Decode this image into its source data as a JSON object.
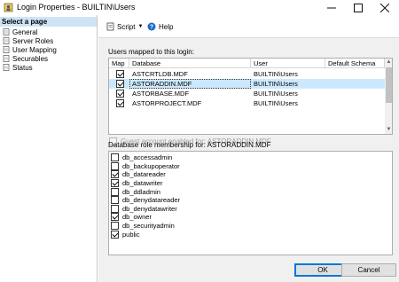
{
  "window": {
    "title": "Login Properties - BUILTIN\\Users",
    "buttons": [
      "minimize",
      "maximize",
      "close"
    ]
  },
  "left_pane": {
    "header": "Select a page",
    "items": [
      {
        "label": "General",
        "icon": "page-icon"
      },
      {
        "label": "Server Roles",
        "icon": "page-icon"
      },
      {
        "label": "User Mapping",
        "icon": "page-icon"
      },
      {
        "label": "Securables",
        "icon": "page-icon"
      },
      {
        "label": "Status",
        "icon": "page-icon"
      }
    ]
  },
  "toolbar": {
    "script_label": "Script",
    "help_label": "Help"
  },
  "users_mapped": {
    "label": "Users mapped to this login:",
    "columns": [
      "Map",
      "Database",
      "User",
      "Default Schema"
    ],
    "rows": [
      {
        "map": true,
        "database": "ASTCRTLDB.MDF",
        "user": "BUILTIN\\Users",
        "schema": "",
        "selected": false
      },
      {
        "map": true,
        "database": "ASTORADDIN.MDF",
        "user": "BUILTIN\\Users",
        "schema": "",
        "selected": true
      },
      {
        "map": true,
        "database": "ASTORBASE.MDF",
        "user": "BUILTIN\\Users",
        "schema": "",
        "selected": false
      },
      {
        "map": true,
        "database": "ASTORPROJECT.MDF",
        "user": "BUILTIN\\Users",
        "schema": "",
        "selected": false
      }
    ]
  },
  "guest_account": {
    "label": "Guest account enabled for: ASTORADDIN.MDF",
    "checked": false
  },
  "role_membership": {
    "label": "Database role membership for: ASTORADDIN.MDF",
    "roles": [
      {
        "name": "db_accessadmin",
        "checked": false
      },
      {
        "name": "db_backupoperator",
        "checked": false
      },
      {
        "name": "db_datareader",
        "checked": true
      },
      {
        "name": "db_datawriter",
        "checked": true
      },
      {
        "name": "db_ddladmin",
        "checked": false
      },
      {
        "name": "db_denydatareader",
        "checked": false
      },
      {
        "name": "db_denydatawriter",
        "checked": false
      },
      {
        "name": "db_owner",
        "checked": true
      },
      {
        "name": "db_securityadmin",
        "checked": false
      },
      {
        "name": "public",
        "checked": true
      }
    ]
  },
  "footer": {
    "ok_label": "OK",
    "cancel_label": "Cancel"
  },
  "colors": {
    "selection": "#cce8ff",
    "left_header": "#cfe3f7",
    "focus_blue": "#0078d7"
  }
}
